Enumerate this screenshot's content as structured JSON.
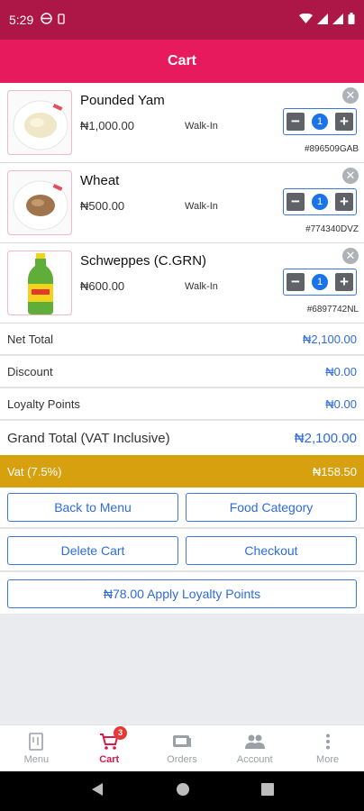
{
  "status_bar": {
    "time": "5:29"
  },
  "app_bar": {
    "title": "Cart"
  },
  "cart": {
    "items": [
      {
        "name": "Pounded Yam",
        "price": "₦1,000.00",
        "type": "Walk-In",
        "code": "#896509GAB",
        "quantity": "1",
        "image_icon": "pounded-yam-plate-image"
      },
      {
        "name": "Wheat",
        "price": "₦500.00",
        "type": "Walk-In",
        "code": "#774340DVZ",
        "quantity": "1",
        "image_icon": "wheat-plate-image"
      },
      {
        "name": "Schweppes (C.GRN)",
        "price": "₦600.00",
        "type": "Walk-In",
        "code": "#6897742NL",
        "quantity": "1",
        "image_icon": "schweppes-bottle-image"
      }
    ]
  },
  "totals": {
    "net_total_label": "Net Total",
    "net_total_value": "₦2,100.00",
    "discount_label": "Discount",
    "discount_value": "₦0.00",
    "loyalty_label": "Loyalty Points",
    "loyalty_value": "₦0.00",
    "grand_total_label": "Grand Total (VAT Inclusive)",
    "grand_total_value": "₦2,100.00"
  },
  "vat": {
    "label": "Vat (7.5%)",
    "value": "₦158.50"
  },
  "actions": {
    "back_to_menu": "Back to Menu",
    "food_category": "Food Category",
    "delete_cart": "Delete Cart",
    "checkout": "Checkout",
    "apply_loyalty": "₦78.00 Apply Loyalty Points"
  },
  "bottom_nav": {
    "items": [
      {
        "label": "Menu",
        "icon": "menu-icon"
      },
      {
        "label": "Cart",
        "icon": "cart-icon",
        "badge": "3",
        "active": true
      },
      {
        "label": "Orders",
        "icon": "orders-icon"
      },
      {
        "label": "Account",
        "icon": "account-icon"
      },
      {
        "label": "More",
        "icon": "more-icon"
      }
    ]
  },
  "colors": {
    "status_bar": "#ad1747",
    "app_bar": "#e61a5c",
    "accent_blue": "#2f6bdc",
    "vat_bar": "#d6a00f",
    "nav_active": "#d81b4a"
  }
}
